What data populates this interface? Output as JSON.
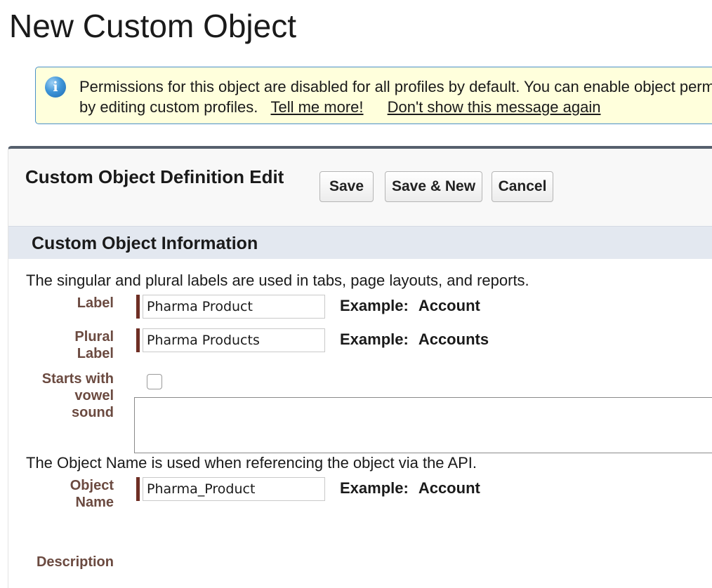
{
  "page": {
    "title": "New Custom Object"
  },
  "info": {
    "icon": "info-icon",
    "line1": "Permissions for this object are disabled for all profiles by default. You can enable object permissions",
    "line2": "by editing custom profiles.",
    "tell_more": "Tell me more!",
    "dont_show": "Don't show this message again"
  },
  "panel": {
    "title": "Custom Object Definition Edit",
    "buttons": {
      "save": "Save",
      "save_new": "Save & New",
      "cancel": "Cancel"
    }
  },
  "section": {
    "title": "Custom Object Information",
    "helper1": "The singular and plural labels are used in tabs, page layouts, and reports.",
    "helper2": "The Object Name is used when referencing the object via the API."
  },
  "fields": {
    "label": {
      "label": "Label",
      "value": "Pharma Product",
      "example_prefix": "Example:",
      "example_value": "Account"
    },
    "plural": {
      "label_line1": "Plural",
      "label_line2": "Label",
      "value": "Pharma Products",
      "example_prefix": "Example:",
      "example_value": "Accounts"
    },
    "vowel": {
      "label_line1": "Starts with",
      "label_line2": "vowel",
      "label_line3": "sound",
      "checked": false
    },
    "object_name": {
      "label_line1": "Object",
      "label_line2": "Name",
      "value": "Pharma_Product",
      "example_prefix": "Example:",
      "example_value": "Account"
    },
    "description": {
      "label": "Description",
      "value": ""
    }
  }
}
